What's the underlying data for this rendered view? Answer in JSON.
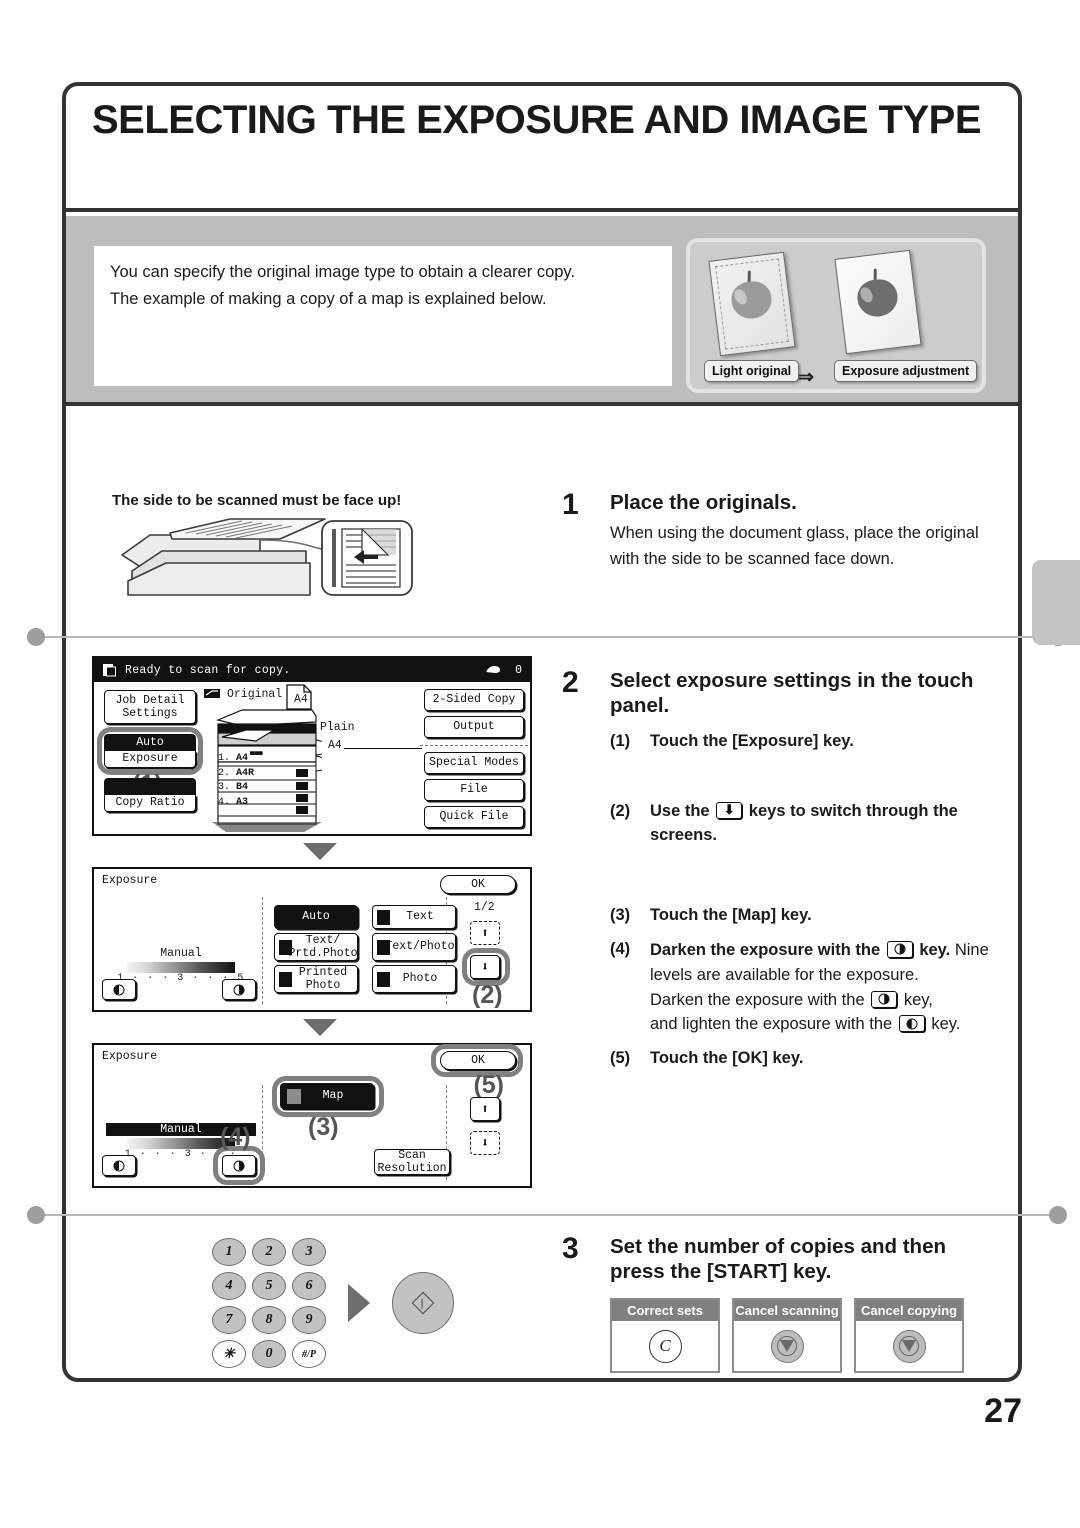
{
  "page": {
    "number": "27",
    "title": "SELECTING THE EXPOSURE AND IMAGE TYPE"
  },
  "intro": {
    "line1": "You can specify the original image type to obtain a clearer copy.",
    "line2": "The example of making a copy of a map is explained below.",
    "tag_light": "Light original",
    "tag_exposure": "Exposure adjustment",
    "arrow": "⇒"
  },
  "step1": {
    "number": "1",
    "face_up_label": "The side to be scanned must be face up!",
    "heading": "Place the originals.",
    "body": "When using the document glass, place the original with the side to be scanned face down."
  },
  "step2": {
    "number": "2",
    "heading": "Select exposure settings in the touch panel.",
    "sub1_num": "(1)",
    "sub1_text": "Touch the [Exposure] key.",
    "sub2_num": "(2)",
    "sub2_text_a": "Use the",
    "sub2_text_b": "keys to switch through the screens.",
    "sub3_num": "(3)",
    "sub3_text": "Touch the [Map] key.",
    "sub4_num": "(4)",
    "sub4_text_a": "Darken the exposure with the",
    "sub4_text_b": "key.",
    "sub4_note_a": "Nine levels are available for the exposure.",
    "sub4_note_b": "Darken the exposure with the",
    "sub4_note_c": "key,",
    "sub4_note_d": "and lighten the exposure with the",
    "sub4_note_e": "key.",
    "sub5_num": "(5)",
    "sub5_text": "Touch the [OK] key."
  },
  "step3": {
    "number": "3",
    "heading": "Set the number of copies and then press the [START] key.",
    "keypad": [
      "1",
      "2",
      "3",
      "4",
      "5",
      "6",
      "7",
      "8",
      "9",
      "✳",
      "0",
      "#/P"
    ],
    "boxes": [
      {
        "label": "Correct sets",
        "glyph": "C"
      },
      {
        "label": "Cancel scanning",
        "glyph": "stop"
      },
      {
        "label": "Cancel copying",
        "glyph": "stop"
      }
    ]
  },
  "screen1": {
    "status": "Ready to scan for copy.",
    "count": "0",
    "left_buttons": [
      {
        "label": "Job Detail\nSettings",
        "selected": false
      },
      {
        "label": "Auto\nExposure",
        "selected": true
      },
      {
        "label": "Copy Ratio",
        "selected": false
      }
    ],
    "center": {
      "original_label": "Original",
      "original_size": "A4",
      "paper_type": "Plain",
      "paper_size": "A4",
      "trays": [
        {
          "n": "1.",
          "size": "A4"
        },
        {
          "n": "2.",
          "size": "A4R"
        },
        {
          "n": "3.",
          "size": "B4"
        },
        {
          "n": "4.",
          "size": "A3"
        }
      ]
    },
    "right_buttons": [
      "2-Sided Copy",
      "Output",
      "Special Modes",
      "File",
      "Quick File"
    ],
    "callout": "(1)"
  },
  "screen2": {
    "title": "Exposure",
    "ok": "OK",
    "page_indicator": "1/2",
    "manual_label": "Manual",
    "ticks": "1 · · · 3 · · · 5",
    "mode_buttons": [
      {
        "label": "Auto",
        "selected": true,
        "icon": false
      },
      {
        "label": "Text",
        "selected": false,
        "icon": true
      },
      {
        "label": "Text/\nPrtd.Photo",
        "selected": false,
        "icon": true
      },
      {
        "label": "Text/Photo",
        "selected": false,
        "icon": true
      },
      {
        "label": "Printed\nPhoto",
        "selected": false,
        "icon": true
      },
      {
        "label": "Photo",
        "selected": false,
        "icon": true
      }
    ],
    "callout": "(2)"
  },
  "screen3": {
    "title": "Exposure",
    "ok": "OK",
    "manual_label": "Manual",
    "ticks": "1 · · · 3 · · ·",
    "map_label": "Map",
    "scan_resolution": "Scan\nResolution",
    "callout_map": "(3)",
    "callout_dark": "(4)",
    "callout_ok": "(5)"
  }
}
